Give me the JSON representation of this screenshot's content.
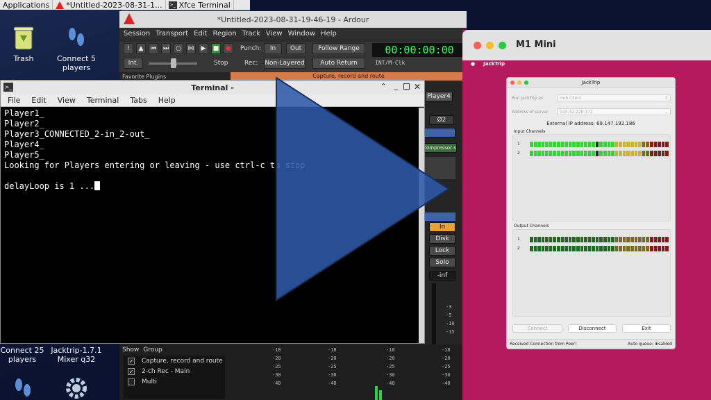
{
  "taskbar": {
    "applications": "Applications",
    "ardour_task": "*Untitled-2023-08-31-1...",
    "terminal_task": "Xfce Terminal"
  },
  "desktop": {
    "icons": [
      {
        "label": "Trash"
      },
      {
        "label": "Connect 5 players"
      },
      {
        "label": "Connect 25 players"
      },
      {
        "label": "Jacktrip-1.7.1 Mixer q32"
      }
    ]
  },
  "ardour": {
    "title": "*Untitled-2023-08-31-19-46-19 - Ardour",
    "menu": [
      "Session",
      "Transport",
      "Edit",
      "Region",
      "Track",
      "View",
      "Window",
      "Help"
    ],
    "punch_label": "Punch:",
    "in_label": "In",
    "out_label": "Out",
    "follow_range": "Follow Range",
    "int_label": "Int.",
    "stop_label": "Stop",
    "rec_label": "Rec:",
    "non_layered": "Non-Layered",
    "auto_return": "Auto Return",
    "clock": "00:00:00:00",
    "clock_source": "INT/M-Clk",
    "favorite_plugins": "Favorite Plugins",
    "capture_banner": "Capture, record and route",
    "player4": "Player4",
    "phase": "Ø2",
    "compressor": "Compressor s",
    "strip_in": "In",
    "strip_disk": "Disk",
    "strip_lock": "Lock",
    "strip_solo": "Solo",
    "strip_inf": "-inf",
    "meter_ticks": [
      "-3",
      "-5",
      "-10",
      "-15"
    ],
    "mixer_ticks": [
      "-18",
      "-20",
      "-25",
      "-30",
      "-40"
    ],
    "group_header": {
      "show": "Show",
      "group": "Group"
    },
    "groups": [
      {
        "name": "Capture, record and route",
        "checked": "✓"
      },
      {
        "name": "2-ch Rec - Main",
        "checked": "✓"
      },
      {
        "name": "Multi",
        "checked": ""
      }
    ]
  },
  "terminal": {
    "title": "Terminal -",
    "menu": [
      "File",
      "Edit",
      "View",
      "Terminal",
      "Tabs",
      "Help"
    ],
    "lines": [
      "Player1_",
      "Player2_",
      "Player3_CONNECTED_2-in_2-out_",
      "Player4_",
      "Player5_",
      "Looking for Players entering or leaving - use ctrl-c to stop",
      "",
      "delayLoop is 1 ..."
    ]
  },
  "mac": {
    "title": "M1 Mini",
    "app_menu": "JackTrip"
  },
  "jacktrip": {
    "title": "JackTrip",
    "run_as_label": "Run JackTrip as",
    "run_as_value": "Hub Client",
    "address_label": "Address of server",
    "address_value": "143.42.228.172",
    "external_ip": "External IP address: 69.147.192.186",
    "input_channels": "Input Channels",
    "output_channels": "Output Channels",
    "ch1": "1",
    "ch2": "2",
    "connect": "Connect",
    "disconnect": "Disconnect",
    "exit": "Exit",
    "status": "Received Connection from Peer!",
    "auto_queue": "Auto queue: disabled",
    "input_levels": [
      0.8,
      0.8
    ],
    "output_levels": [
      0.0,
      0.0
    ]
  },
  "colors": {
    "mac_bg": "#b5195e",
    "clock_green": "#3aff5a",
    "play_blue": "#2e5aa8"
  }
}
